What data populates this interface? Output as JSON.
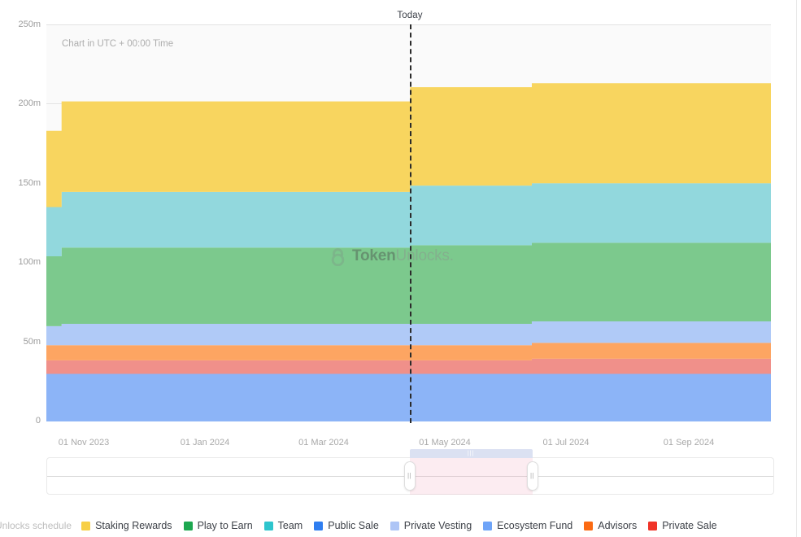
{
  "header": {
    "today_label": "Today"
  },
  "chart_note": "Chart in UTC + 00:00 Time",
  "watermark": {
    "icon": "lock-icon",
    "text_bold": "Token",
    "text_light": "Unlocks."
  },
  "legend": {
    "title": "Unlocks schedule",
    "items": [
      {
        "label": "Staking Rewards",
        "color": "#f7cf46"
      },
      {
        "label": "Play to Earn",
        "color": "#1da750"
      },
      {
        "label": "Team",
        "color": "#2ec5cd"
      },
      {
        "label": "Public Sale",
        "color": "#2f7ef0"
      },
      {
        "label": "Private Vesting",
        "color": "#aec5f6"
      },
      {
        "label": "Ecosystem Fund",
        "color": "#6ea4f8"
      },
      {
        "label": "Advisors",
        "color": "#fb6a13"
      },
      {
        "label": "Private Sale",
        "color": "#f03428"
      }
    ]
  },
  "range_slider": {
    "left_handle_grip": "||",
    "right_handle_grip": "||",
    "drag_bar_grip": "|||",
    "selection_start_pct": 49.9,
    "selection_end_pct": 66.8
  },
  "chart_data": {
    "type": "area",
    "title": "",
    "subtitle": "Chart in UTC + 00:00 Time",
    "xlabel": "",
    "ylabel": "",
    "stacked": true,
    "step": true,
    "grid": true,
    "legend_position": "bottom",
    "ylim": [
      0,
      250000000
    ],
    "ytick_labels": [
      "0",
      "50m",
      "100m",
      "150m",
      "200m",
      "250m"
    ],
    "ytick_values": [
      0,
      50000000,
      100000000,
      150000000,
      200000000,
      250000000
    ],
    "xtick_labels": [
      "01 Nov 2023",
      "01 Jan 2024",
      "01 Mar 2024",
      "01 May 2024",
      "01 Jul 2024",
      "01 Sep 2024"
    ],
    "x": [
      "01 Oct 2023",
      "01 Nov 2023",
      "01 Jan 2024",
      "01 Mar 2024",
      "12 Apr 2024",
      "01 May 2024",
      "01 Jun 2024",
      "01 Jul 2024",
      "01 Sep 2024",
      "01 Oct 2024"
    ],
    "today_marker": {
      "label": "Today",
      "x": "12 Apr 2024",
      "x_pct": 50.2
    },
    "stack_order_bottom_to_top": [
      "Ecosystem Fund",
      "Private Sale",
      "Advisors",
      "Private Vesting",
      "Play to Earn",
      "Team",
      "Staking Rewards"
    ],
    "series": [
      {
        "name": "Ecosystem Fund",
        "color": "#8cb4f7",
        "values": [
          30000000,
          30000000,
          30000000,
          30000000,
          30000000,
          30000000,
          30000000,
          30000000,
          30000000,
          30000000
        ]
      },
      {
        "name": "Private Sale",
        "color": "#f0908a",
        "values": [
          8500000,
          8500000,
          8500000,
          8500000,
          8500000,
          8500000,
          8500000,
          9500000,
          9500000,
          9500000
        ]
      },
      {
        "name": "Advisors",
        "color": "#fda562",
        "values": [
          9500000,
          9500000,
          9500000,
          9500000,
          9500000,
          9500000,
          9500000,
          10000000,
          10000000,
          10000000
        ]
      },
      {
        "name": "Private Vesting",
        "color": "#b0caf7",
        "values": [
          12000000,
          13500000,
          13500000,
          13500000,
          13500000,
          13500000,
          13500000,
          13500000,
          13500000,
          13500000
        ]
      },
      {
        "name": "Play to Earn",
        "color": "#7cc98d",
        "values": [
          44000000,
          48000000,
          48000000,
          48000000,
          48000000,
          49500000,
          49500000,
          49500000,
          49500000,
          49500000
        ]
      },
      {
        "name": "Team",
        "color": "#92d8dd",
        "values": [
          31000000,
          35000000,
          35000000,
          35000000,
          35000000,
          37500000,
          37500000,
          37500000,
          37500000,
          37500000
        ]
      },
      {
        "name": "Staking Rewards",
        "color": "#f8d55f",
        "values": [
          48000000,
          57000000,
          57000000,
          57000000,
          57000000,
          62000000,
          62000000,
          63000000,
          63000000,
          63000000
        ]
      }
    ],
    "stack_totals": [
      183000000,
      201500000,
      201500000,
      201500000,
      201500000,
      210000000,
      210000000,
      213000000,
      213000000,
      213000000
    ]
  }
}
